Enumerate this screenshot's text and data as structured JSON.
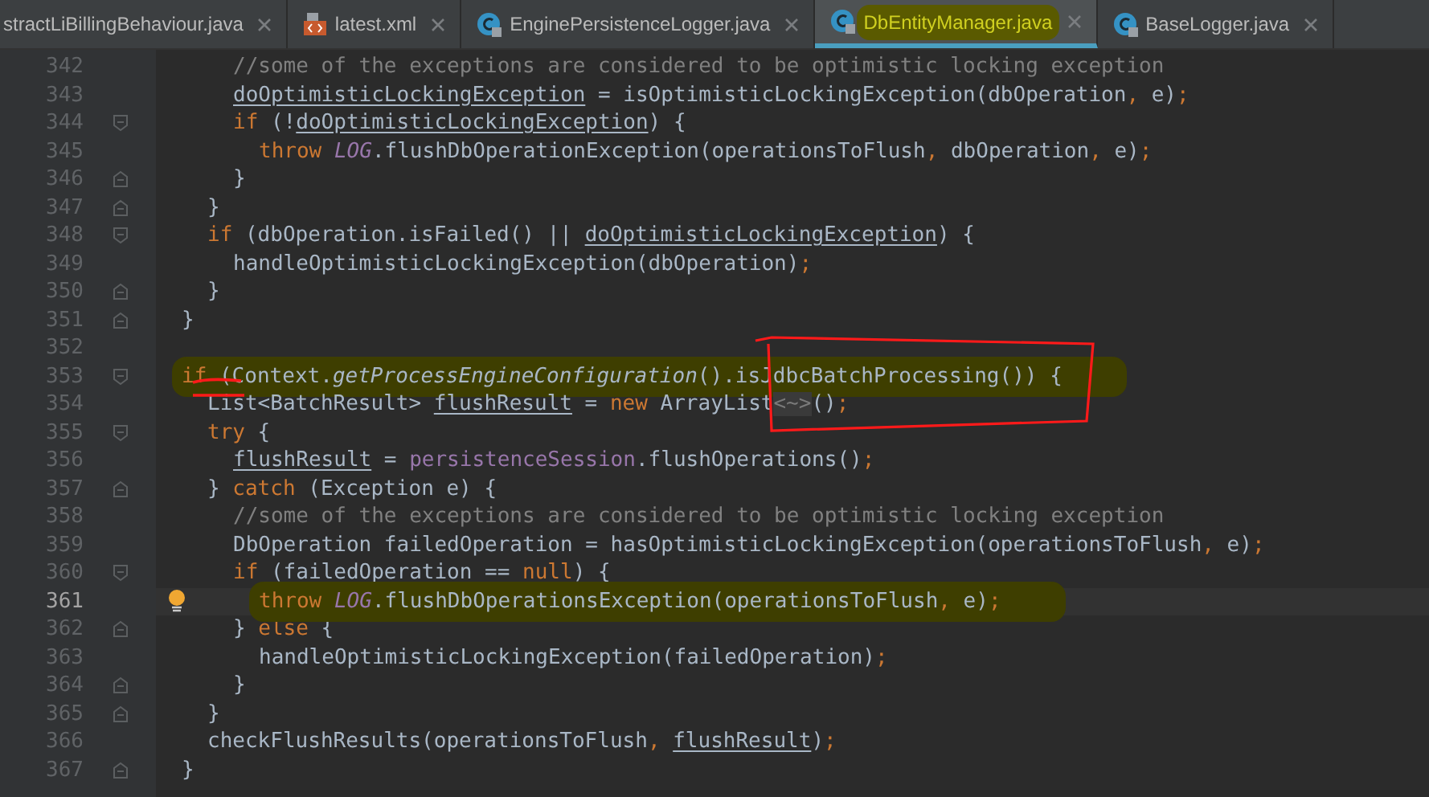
{
  "tabs": [
    {
      "label": "stractLiBillingBehaviour.java",
      "kind": "none",
      "selected": false,
      "marked": false
    },
    {
      "label": "latest.xml",
      "kind": "xml",
      "selected": false,
      "marked": false
    },
    {
      "label": "EnginePersistenceLogger.java",
      "kind": "class",
      "selected": false,
      "marked": false
    },
    {
      "label": "DbEntityManager.java",
      "kind": "class",
      "selected": true,
      "marked": true
    },
    {
      "label": "BaseLogger.java",
      "kind": "class",
      "selected": false,
      "marked": false
    }
  ],
  "editor": {
    "lines": [
      {
        "children": [
          {
            "children": [
              {
                "number": "342",
                "kind": "code",
                "current": false,
                "tokens": [
                  {
                    "kind": "cm",
                    "text": "//some of the exceptions are considered to be optimistic locking exception"
                  }
                ]
              },
              {
                "number": "343",
                "kind": "code",
                "current": false,
                "tokens": [
                  {
                    "kind": "ul",
                    "text": "doOptimisticLockingException"
                  },
                  {
                    "kind": "id",
                    "text": " = isOptimisticLockingException(dbOperation"
                  },
                  {
                    "kind": "p",
                    "text": ","
                  },
                  {
                    "kind": "id",
                    "text": " e)"
                  },
                  {
                    "kind": "p",
                    "text": ";"
                  }
                ]
              },
              {
                "number": "344",
                "kind": "code",
                "current": false,
                "tokens": [
                  {
                    "kind": "kw",
                    "text": "if"
                  },
                  {
                    "kind": "id",
                    "text": " (!"
                  },
                  {
                    "kind": "ul",
                    "text": "doOptimisticLockingException"
                  },
                  {
                    "kind": "id",
                    "text": ") {"
                  }
                ],
                "children": [
                  {
                    "number": "345",
                    "kind": "code",
                    "current": false,
                    "tokens": [
                      {
                        "kind": "kw",
                        "text": "throw "
                      },
                      {
                        "kind": "st",
                        "text": "LOG"
                      },
                      {
                        "kind": "id",
                        "text": ".flushDbOperationException(operationsToFlush"
                      },
                      {
                        "kind": "p",
                        "text": ","
                      },
                      {
                        "kind": "id",
                        "text": " dbOperation"
                      },
                      {
                        "kind": "p",
                        "text": ","
                      },
                      {
                        "kind": "id",
                        "text": " e)"
                      },
                      {
                        "kind": "p",
                        "text": ";"
                      }
                    ]
                  }
                ]
              },
              {
                "number": "346",
                "kind": "close",
                "current": false,
                "tokens": [
                  {
                    "kind": "id",
                    "text": "}"
                  }
                ]
              }
            ]
          },
          {
            "number": "347",
            "kind": "close",
            "current": false,
            "tokens": [
              {
                "kind": "id",
                "text": "}"
              }
            ]
          },
          {
            "number": "348",
            "kind": "code",
            "current": false,
            "tokens": [
              {
                "kind": "kw",
                "text": "if"
              },
              {
                "kind": "id",
                "text": " (dbOperation.isFailed() || "
              },
              {
                "kind": "ul",
                "text": "doOptimisticLockingException"
              },
              {
                "kind": "id",
                "text": ") {"
              }
            ],
            "children": [
              {
                "number": "349",
                "kind": "code",
                "current": false,
                "tokens": [
                  {
                    "kind": "id",
                    "text": "handleOptimisticLockingException(dbOperation)"
                  },
                  {
                    "kind": "p",
                    "text": ";"
                  }
                ]
              }
            ]
          },
          {
            "number": "350",
            "kind": "close",
            "current": false,
            "tokens": [
              {
                "kind": "id",
                "text": "}"
              }
            ]
          }
        ]
      },
      {
        "number": "351",
        "kind": "close",
        "current": false,
        "tokens": [
          {
            "kind": "id",
            "text": "}"
          }
        ]
      },
      {
        "number": "352",
        "kind": "blank",
        "current": false
      },
      {
        "number": "353",
        "kind": "code",
        "current": false,
        "marked": true,
        "tokens": [
          {
            "kind": "kw",
            "text": "if"
          },
          {
            "kind": "id",
            "text": " (Context."
          },
          {
            "kind": "mi",
            "text": "getProcessEngineConfiguration"
          },
          {
            "kind": "id",
            "text": "().isJdbcBatchProcessing()) {"
          }
        ],
        "children": [
          {
            "number": "354",
            "kind": "code",
            "current": false,
            "tokens": [
              {
                "kind": "id",
                "text": "List<BatchResult> "
              },
              {
                "kind": "ul",
                "text": "flushResult"
              },
              {
                "kind": "id",
                "text": " = "
              },
              {
                "kind": "kw",
                "text": "new "
              },
              {
                "kind": "id",
                "text": "ArrayList"
              },
              {
                "kind": "fold",
                "text": "<~>"
              },
              {
                "kind": "id",
                "text": "()"
              },
              {
                "kind": "p",
                "text": ";"
              }
            ]
          },
          {
            "number": "355",
            "kind": "code",
            "current": false,
            "tokens": [
              {
                "kind": "kw",
                "text": "try"
              },
              {
                "kind": "id",
                "text": " {"
              }
            ],
            "children": [
              {
                "number": "356",
                "kind": "code",
                "current": false,
                "tokens": [
                  {
                    "kind": "ul",
                    "text": "flushResult"
                  },
                  {
                    "kind": "id",
                    "text": " = "
                  },
                  {
                    "kind": "fd",
                    "text": "persistenceSession"
                  },
                  {
                    "kind": "id",
                    "text": ".flushOperations()"
                  },
                  {
                    "kind": "p",
                    "text": ";"
                  }
                ]
              }
            ]
          },
          {
            "number": "357",
            "kind": "close",
            "current": false,
            "tokens": [
              {
                "kind": "id",
                "text": "} "
              },
              {
                "kind": "kw",
                "text": "catch"
              },
              {
                "kind": "id",
                "text": " (Exception e) {"
              }
            ],
            "children": [
              {
                "number": "358",
                "kind": "code",
                "current": false,
                "tokens": [
                  {
                    "kind": "cm",
                    "text": "//some of the exceptions are considered to be optimistic locking exception"
                  }
                ]
              },
              {
                "number": "359",
                "kind": "code",
                "current": false,
                "tokens": [
                  {
                    "kind": "id",
                    "text": "DbOperation failedOperation = hasOptimisticLockingException(operationsToFlush"
                  },
                  {
                    "kind": "p",
                    "text": ","
                  },
                  {
                    "kind": "id",
                    "text": " e)"
                  },
                  {
                    "kind": "p",
                    "text": ";"
                  }
                ]
              },
              {
                "number": "360",
                "kind": "code",
                "current": false,
                "tokens": [
                  {
                    "kind": "kw",
                    "text": "if"
                  },
                  {
                    "kind": "id",
                    "text": " (failedOperation == "
                  },
                  {
                    "kind": "kw",
                    "text": "null"
                  },
                  {
                    "kind": "id",
                    "text": ") {"
                  }
                ],
                "children": [
                  {
                    "number": "361",
                    "kind": "code",
                    "current": true,
                    "marked": true,
                    "tokens": [
                      {
                        "kind": "kw",
                        "text": "throw "
                      },
                      {
                        "kind": "st",
                        "text": "LOG"
                      },
                      {
                        "kind": "id",
                        "text": ".flushDbOperationsException(operationsToFlush"
                      },
                      {
                        "kind": "p",
                        "text": ","
                      },
                      {
                        "kind": "id",
                        "text": " e)"
                      },
                      {
                        "kind": "p",
                        "text": ";"
                      }
                    ]
                  }
                ]
              },
              {
                "number": "362",
                "kind": "close",
                "current": false,
                "tokens": [
                  {
                    "kind": "id",
                    "text": "} "
                  },
                  {
                    "kind": "kw",
                    "text": "else"
                  },
                  {
                    "kind": "id",
                    "text": " {"
                  }
                ],
                "children": [
                  {
                    "number": "363",
                    "kind": "code",
                    "current": false,
                    "tokens": [
                      {
                        "kind": "id",
                        "text": "handleOptimisticLockingException(failedOperation)"
                      },
                      {
                        "kind": "p",
                        "text": ";"
                      }
                    ]
                  }
                ]
              },
              {
                "number": "364",
                "kind": "close",
                "current": false,
                "tokens": [
                  {
                    "kind": "id",
                    "text": "}"
                  }
                ]
              }
            ]
          },
          {
            "number": "365",
            "kind": "close",
            "current": false,
            "tokens": [
              {
                "kind": "id",
                "text": "}"
              }
            ]
          },
          {
            "number": "366",
            "kind": "code",
            "current": false,
            "tokens": [
              {
                "kind": "id",
                "text": "checkFlushResults(operationsToFlush"
              },
              {
                "kind": "p",
                "text": ", "
              },
              {
                "kind": "ul",
                "text": "flushResult"
              },
              {
                "kind": "id",
                "text": ")"
              },
              {
                "kind": "p",
                "text": ";"
              }
            ]
          }
        ]
      },
      {
        "number": "367",
        "kind": "close",
        "current": false,
        "tokens": [
          {
            "kind": "id",
            "text": "}"
          }
        ]
      }
    ]
  }
}
